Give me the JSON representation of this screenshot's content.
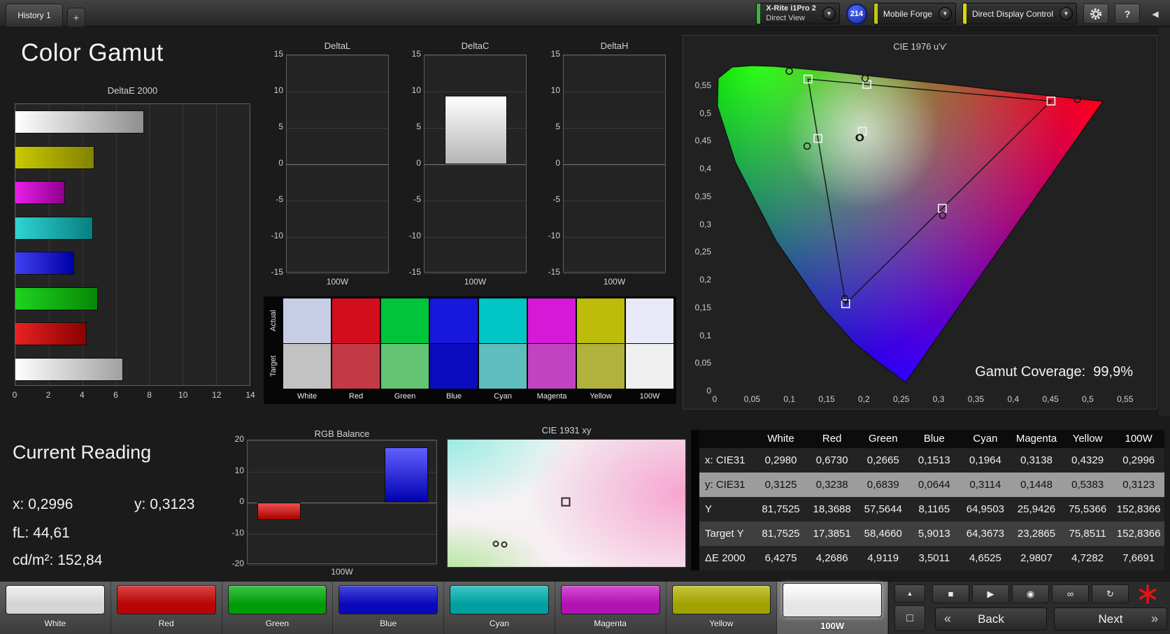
{
  "icons": {
    "chevron_down": "▼",
    "chevron_up": "▲",
    "collapse_left": "◀",
    "help": "?",
    "square_outline": "□",
    "back_chevron": "«",
    "next_chevron": "»"
  },
  "top_bar": {
    "tab_label": "History 1",
    "new_tab_label": "+",
    "meter_button": {
      "line1": "X-Rite i1Pro 2",
      "line2": "Direct View",
      "accent": "#35b83a"
    },
    "badge": "214",
    "source_button": {
      "label": "Mobile Forge",
      "accent": "#c6c614"
    },
    "display_button": {
      "label": "Direct Display Control",
      "accent": "#d8d800"
    }
  },
  "page_title": "Color Gamut",
  "delta_e_chart": {
    "type": "bar",
    "title": "DeltaE 2000",
    "orientation": "horizontal",
    "categories": [
      "100W",
      "Yellow",
      "Magenta",
      "Cyan",
      "Blue",
      "Green",
      "Red",
      "White"
    ],
    "values": [
      7.6691,
      4.7282,
      2.9807,
      4.6525,
      3.5011,
      4.9119,
      4.2686,
      6.4275
    ],
    "bar_colors": [
      [
        "#ffffff",
        "#8f8f8f"
      ],
      [
        "#c9c900",
        "#828200"
      ],
      [
        "#e81ee8",
        "#8f008f"
      ],
      [
        "#2fd4d4",
        "#077f7f"
      ],
      [
        "#4040f2",
        "#0000a8"
      ],
      [
        "#1ed41e",
        "#068806"
      ],
      [
        "#e82222",
        "#8a0000"
      ],
      [
        "#ffffff",
        "#a0a0a0"
      ]
    ],
    "xlim": [
      0,
      14
    ],
    "x_ticks": [
      "0",
      "2",
      "4",
      "6",
      "8",
      "10",
      "12",
      "14"
    ]
  },
  "delta_charts": [
    {
      "type": "bar",
      "title": "DeltaL",
      "category": "100W",
      "value": 0,
      "ylim": [
        -15,
        15
      ],
      "y_ticks": [
        "15",
        "10",
        "5",
        "0",
        "-5",
        "-10",
        "-15"
      ]
    },
    {
      "type": "bar",
      "title": "DeltaC",
      "category": "100W",
      "value": 9.4,
      "ylim": [
        -15,
        15
      ],
      "y_ticks": [
        "15",
        "10",
        "5",
        "0",
        "-5",
        "-10",
        "-15"
      ]
    },
    {
      "type": "bar",
      "title": "DeltaH",
      "category": "100W",
      "value": 0,
      "ylim": [
        -15,
        15
      ],
      "y_ticks": [
        "15",
        "10",
        "5",
        "0",
        "-5",
        "-10",
        "-15"
      ]
    }
  ],
  "swatch_strip": {
    "row_labels": [
      "Actual",
      "Target"
    ],
    "columns": [
      "White",
      "Red",
      "Green",
      "Blue",
      "Cyan",
      "Magenta",
      "Yellow",
      "100W"
    ],
    "actual_colors": [
      "#c7cde4",
      "#d40d1c",
      "#00c43c",
      "#1717dd",
      "#00c6c6",
      "#d619d6",
      "#bcbc09",
      "#e8e9f8"
    ],
    "target_colors": [
      "#c2c2c2",
      "#c13a45",
      "#63c473",
      "#0b0bbf",
      "#5fbdbd",
      "#c243c2",
      "#b1b13d",
      "#efefef"
    ]
  },
  "cie1976": {
    "title": "CIE 1976 u'v'",
    "x_ticks": [
      "0",
      "0,05",
      "0,1",
      "0,15",
      "0,2",
      "0,25",
      "0,3",
      "0,35",
      "0,4",
      "0,45",
      "0,5",
      "0,55"
    ],
    "y_ticks": [
      "0,55",
      "0,5",
      "0,45",
      "0,4",
      "0,35",
      "0,3",
      "0,25",
      "0,2",
      "0,15",
      "0,1",
      "0,05",
      "0"
    ],
    "gamut_coverage_label": "Gamut Coverage:",
    "gamut_coverage_value": "99,9%",
    "triangle": [
      [
        0.4507,
        0.5229
      ],
      [
        0.125,
        0.5625
      ],
      [
        0.1754,
        0.1579
      ]
    ],
    "targets": [
      [
        0.1978,
        0.4683
      ],
      [
        0.4507,
        0.5229
      ],
      [
        0.125,
        0.5625
      ],
      [
        0.1754,
        0.1579
      ],
      [
        0.1384,
        0.4555
      ],
      [
        0.305,
        0.3298
      ],
      [
        0.2039,
        0.5529
      ]
    ],
    "measured": [
      [
        0.1937,
        0.457
      ],
      [
        0.486,
        0.5261
      ],
      [
        0.0999,
        0.5767
      ],
      [
        0.1744,
        0.167
      ],
      [
        0.1238,
        0.4418
      ],
      [
        0.3054,
        0.3171
      ],
      [
        0.2015,
        0.5637
      ],
      [
        0.1949,
        0.4571
      ]
    ]
  },
  "current_reading": {
    "title": "Current Reading",
    "x_label": "x:",
    "x_value": "0,2996",
    "y_label": "y:",
    "y_value": "0,3123",
    "fl_label": "fL:",
    "fl_value": "44,61",
    "cd_label": "cd/m²:",
    "cd_value": "152,84"
  },
  "rgb_balance": {
    "type": "bar",
    "title": "RGB Balance",
    "categories": [
      "Red",
      "Green",
      "Blue"
    ],
    "values": [
      -5.6,
      0,
      17.8
    ],
    "bar_colors": [
      [
        "#f05050",
        "#a80000"
      ],
      [
        "#30c030",
        "#008000"
      ],
      [
        "#6060ff",
        "#0000b0"
      ]
    ],
    "ylim": [
      -20,
      20
    ],
    "y_ticks": [
      "20",
      "10",
      "0",
      "-10",
      "-20"
    ],
    "x_label": "100W"
  },
  "cie1931": {
    "title": "CIE 1931 xy",
    "square": [
      0.497,
      0.49
    ],
    "circles": [
      [
        0.203,
        0.82
      ],
      [
        0.2375,
        0.826
      ]
    ]
  },
  "table": {
    "columns": [
      "White",
      "Red",
      "Green",
      "Blue",
      "Cyan",
      "Magenta",
      "Yellow",
      "100W"
    ],
    "rows": [
      {
        "label": "x: CIE31",
        "highlight": false,
        "values": [
          "0,2980",
          "0,6730",
          "0,2665",
          "0,1513",
          "0,1964",
          "0,3138",
          "0,4329",
          "0,2996"
        ]
      },
      {
        "label": "y: CIE31",
        "highlight": true,
        "values": [
          "0,3125",
          "0,3238",
          "0,6839",
          "0,0644",
          "0,3114",
          "0,1448",
          "0,5383",
          "0,3123"
        ]
      },
      {
        "label": "Y",
        "highlight": false,
        "values": [
          "81,7525",
          "18,3688",
          "57,5644",
          "8,1165",
          "64,9503",
          "25,9426",
          "75,5366",
          "152,8366"
        ]
      },
      {
        "label": "Target Y",
        "highlight": false,
        "values": [
          "81,7525",
          "17,3851",
          "58,4660",
          "5,9013",
          "64,3673",
          "23,2865",
          "75,8511",
          "152,8366"
        ]
      },
      {
        "label": "ΔE 2000",
        "highlight": false,
        "values": [
          "6,4275",
          "4,2686",
          "4,9119",
          "3,5011",
          "4,6525",
          "2,9807",
          "4,7282",
          "7,6691"
        ]
      }
    ]
  },
  "bottom_bar": {
    "patches": [
      {
        "label": "White",
        "color": "#ededed",
        "selected": false
      },
      {
        "label": "Red",
        "color": "#cc0606",
        "selected": false
      },
      {
        "label": "Green",
        "color": "#00ae09",
        "selected": false
      },
      {
        "label": "Blue",
        "color": "#0a0ace",
        "selected": false
      },
      {
        "label": "Cyan",
        "color": "#00b2b2",
        "selected": false
      },
      {
        "label": "Magenta",
        "color": "#c614c6",
        "selected": false
      },
      {
        "label": "Yellow",
        "color": "#b3b300",
        "selected": false
      },
      {
        "label": "100W",
        "color": "#ffffff",
        "selected": true
      }
    ],
    "transport": [
      {
        "name": "stop",
        "glyph": "■"
      },
      {
        "name": "play",
        "glyph": "▶"
      },
      {
        "name": "measure",
        "glyph": "◉"
      },
      {
        "name": "continuous",
        "glyph": "∞"
      },
      {
        "name": "reset",
        "glyph": "↻"
      }
    ],
    "back_label": "Back",
    "next_label": "Next"
  }
}
